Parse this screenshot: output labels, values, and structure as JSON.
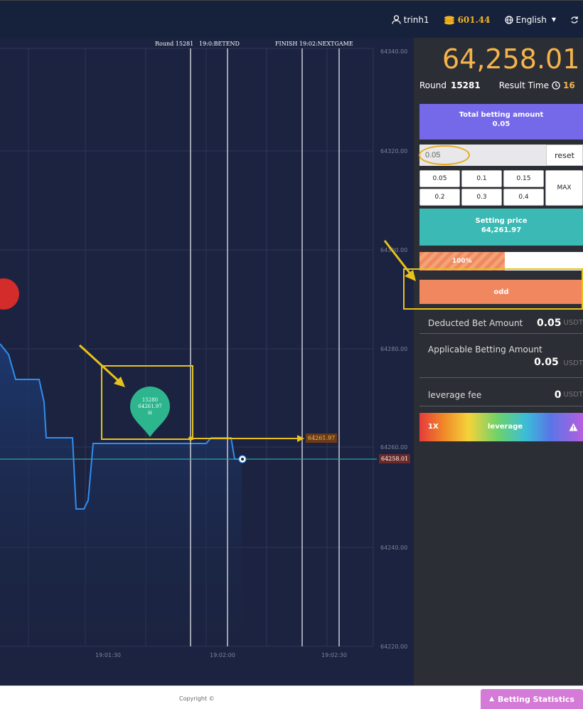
{
  "header": {
    "username": "trinh1",
    "balance": "601.44",
    "language": "English"
  },
  "chart": {
    "round_label": "Round 15281",
    "bet_time": "19:0:BETEND",
    "finish_label": "FINISH 19:02:NEXTGAME",
    "y_ticks": [
      "64340.00",
      "64320.00",
      "64300.00",
      "64280.00",
      "64260.00",
      "64240.00",
      "64220.00"
    ],
    "x_ticks": [
      "19:01:30",
      "19:02:00",
      "19:02:30"
    ],
    "current_price_tag": "64258.01",
    "setting_price_tag": "64261.97",
    "marker": {
      "round": "15280",
      "price": "64261.97"
    }
  },
  "panel": {
    "price": "64,258.01",
    "round_label": "Round",
    "round_value": "15281",
    "result_time_label": "Result Time",
    "result_time_value": "16",
    "total_label": "Total betting amount",
    "total_value": "0.05",
    "amount_input": "0.05",
    "reset_label": "reset",
    "quick_amounts": [
      "0.05",
      "0.1",
      "0.15",
      "0.2",
      "0.3",
      "0.4"
    ],
    "max_label": "MAX",
    "setting_price_label": "Setting price",
    "setting_price_value": "64,261.97",
    "percent_label": "100%",
    "percent_value": 0.52,
    "odd_label": "odd",
    "deducted_label": "Deducted Bet Amount",
    "deducted_value": "0.05",
    "applicable_label": "Applicable Betting Amount",
    "applicable_value": "0.05",
    "leverage_fee_label": "leverage fee",
    "leverage_fee_value": "0",
    "unit": "USDT",
    "leverage_multiplier": "1X",
    "leverage_label": "leverage"
  },
  "footer": {
    "copyright": "Copyright ©",
    "stats_label": "Betting Statistics"
  },
  "colors": {
    "accent_price": "#f6b44b",
    "total_box": "#7569e9",
    "setting_box": "#3bbab5",
    "odd_button": "#f0875f",
    "highlight": "#e8c21b"
  }
}
